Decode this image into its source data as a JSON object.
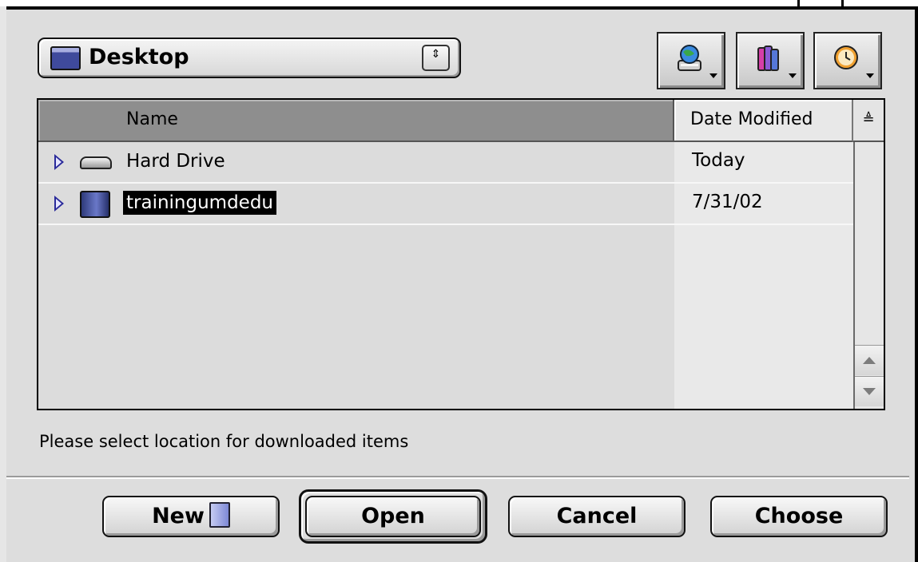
{
  "location_popup": {
    "label": "Desktop",
    "arrows": "⇕"
  },
  "shortcuts": [
    {
      "name": "shortcuts"
    },
    {
      "name": "favorites"
    },
    {
      "name": "recent"
    }
  ],
  "list": {
    "columns": {
      "name": "Name",
      "date": "Date Modified",
      "sort_glyph": "≜"
    },
    "rows": [
      {
        "name": "Hard Drive",
        "date": "Today",
        "icon": "hard-drive-icon",
        "selected": false
      },
      {
        "name": "trainingumdedu",
        "date": "7/31/02",
        "icon": "server-volume-icon",
        "selected": true
      }
    ]
  },
  "prompt": "Please select location for downloaded items",
  "buttons": {
    "new": "New",
    "open": "Open",
    "cancel": "Cancel",
    "choose": "Choose"
  }
}
